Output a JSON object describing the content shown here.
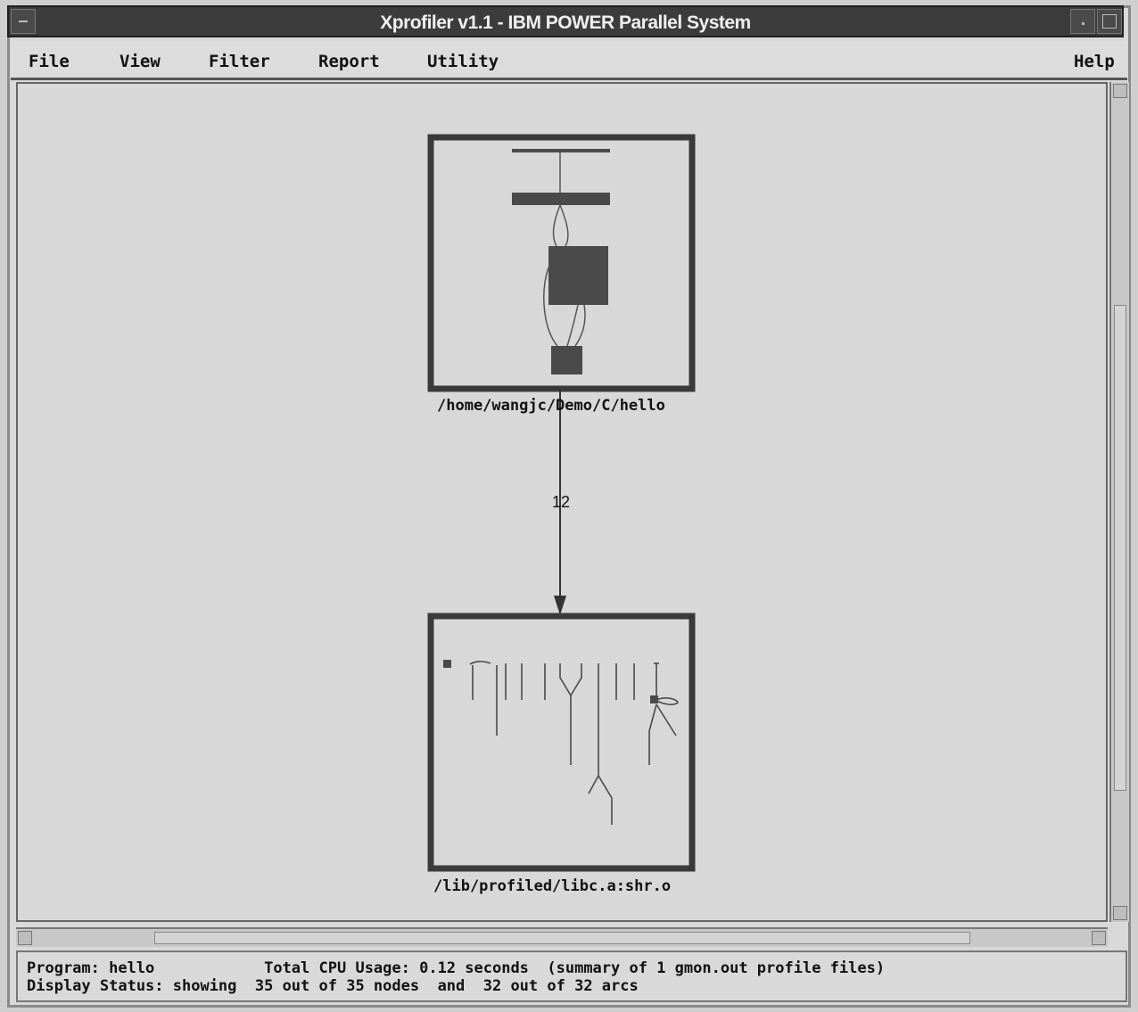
{
  "window": {
    "title": "Xprofiler v1.1 - IBM POWER Parallel System"
  },
  "menubar": {
    "items": [
      {
        "label": "File"
      },
      {
        "label": "View"
      },
      {
        "label": "Filter"
      },
      {
        "label": "Report"
      },
      {
        "label": "Utility"
      }
    ],
    "help": "Help"
  },
  "graph": {
    "clusters": [
      {
        "label": "/home/wangjc/Demo/C/hello"
      },
      {
        "label": "/lib/profiled/libc.a:shr.o"
      }
    ],
    "arc": {
      "label": "12"
    }
  },
  "status": {
    "line1": "Program: hello            Total CPU Usage: 0.12 seconds  (summary of 1 gmon.out profile files)",
    "line2": "Display Status: showing  35 out of 35 nodes  and  32 out of 32 arcs"
  },
  "icons": {
    "window_menu": "window-menu-icon",
    "minimize": "minimize-icon",
    "maximize": "maximize-icon"
  }
}
